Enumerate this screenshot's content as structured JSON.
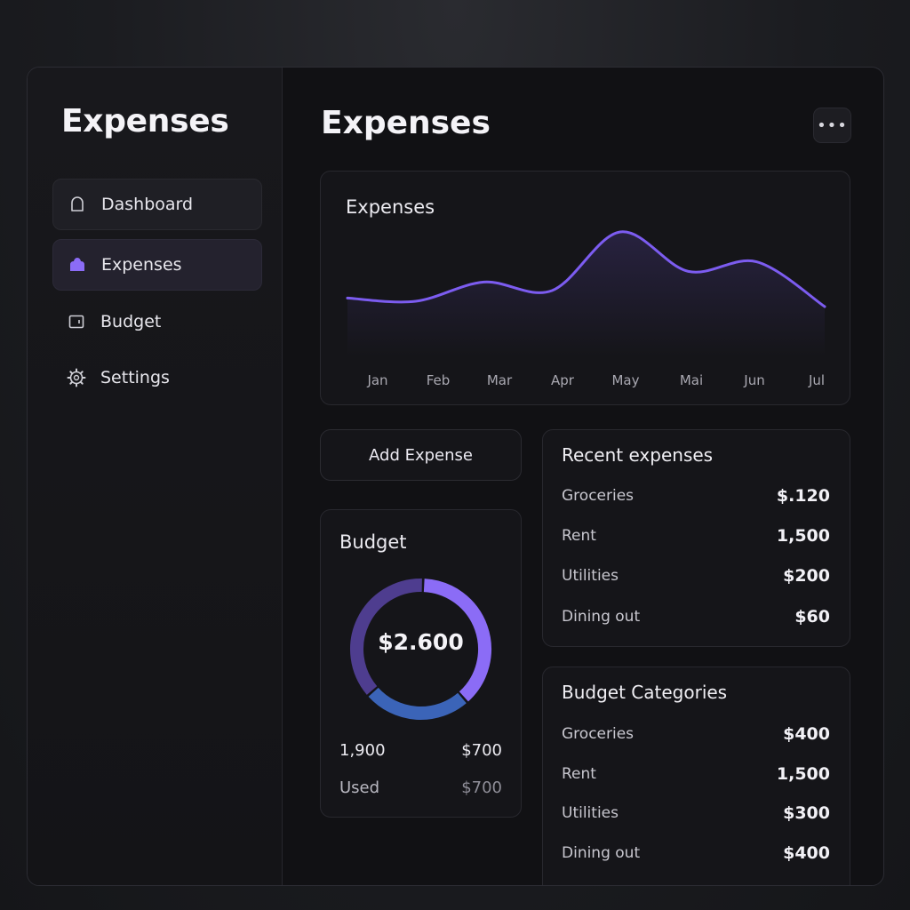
{
  "sidebar": {
    "title": "Expenses",
    "items": [
      {
        "label": "Dashboard",
        "icon": "bell-icon"
      },
      {
        "label": "Expenses",
        "icon": "wallet-icon"
      },
      {
        "label": "Budget",
        "icon": "budget-icon"
      },
      {
        "label": "Settings",
        "icon": "gear-icon"
      }
    ]
  },
  "main": {
    "title": "Expenses",
    "more_label": "•••",
    "add_expense_label": "Add Expense"
  },
  "chart_data": {
    "type": "line",
    "title": "Expenses",
    "categories": [
      "Jan",
      "Feb",
      "Mar",
      "Apr",
      "May",
      "Mai",
      "Jun",
      "Jul"
    ],
    "series": [
      {
        "values": [
          38,
          35,
          53,
          45,
          100,
          63,
          72,
          30
        ]
      }
    ],
    "grid": false,
    "line_color": "#7c5cf0",
    "fill": "area"
  },
  "budget": {
    "title": "Budget",
    "total": "$2.600",
    "row1_left": "1,900",
    "row1_right": "$700",
    "row2_left": "Used",
    "row2_right": "$700",
    "segments": [
      {
        "fraction": 0.38,
        "color": "#8b6cf6"
      },
      {
        "fraction": 0.25,
        "color": "#3b64b8"
      },
      {
        "fraction": 0.37,
        "color": "#4e3d8f"
      }
    ]
  },
  "recent": {
    "title": "Recent expenses",
    "rows": [
      {
        "name": "Groceries",
        "amount": "$.120"
      },
      {
        "name": "Rent",
        "amount": "1,500"
      },
      {
        "name": "Utilities",
        "amount": "$200"
      },
      {
        "name": "Dining out",
        "amount": "$60"
      }
    ]
  },
  "categories": {
    "title": "Budget Categories",
    "rows": [
      {
        "name": "Groceries",
        "amount": "$400"
      },
      {
        "name": "Rent",
        "amount": "1,500"
      },
      {
        "name": "Utilities",
        "amount": "$300"
      },
      {
        "name": "Dining out",
        "amount": "$400"
      }
    ]
  },
  "colors": {
    "accent": "#7c5cf0",
    "background": "#111114",
    "card": "#151519"
  }
}
